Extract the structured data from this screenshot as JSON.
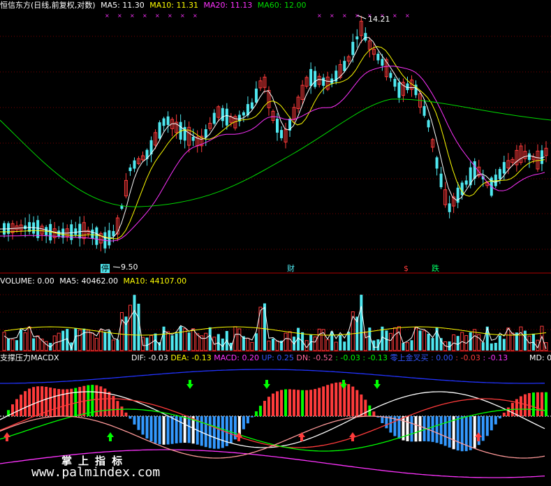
{
  "app": {
    "title": "恒信东方(日线,前复权,对数)"
  },
  "price_panel": {
    "ma5_label": "MA5: 11.30",
    "ma10_label": "MA10: 11.31",
    "ma20_label": "MA20: 11.13",
    "ma60_label": "MA60: 12.00",
    "high_label": "14.21",
    "low_label": "9.50",
    "event_tags": [
      "停",
      "财",
      "$",
      "跌"
    ],
    "colors": {
      "up": "#ff3b3b",
      "down": "#4fe8f0",
      "ma5": "#ffffff",
      "ma10": "#ffff00",
      "ma20": "#ff33ff",
      "ma60": "#00dd00",
      "grid": "#7a0000"
    }
  },
  "volume_panel": {
    "vol_label": "VOLUME: 0.00",
    "ma5_label": "MA5: 40462.00",
    "ma10_label": "MA10: 44107.00"
  },
  "indicator_panel": {
    "name": "支撑压力MACDX",
    "dif": "DIF: -0.03",
    "dea": "DEA: -0.13",
    "macd": "MACD: 0.20",
    "up": "UP: 0.25",
    "dn": "DN: -0.52",
    "v1": ": -0.03",
    "v2": ": -0.13",
    "signal": "零上金叉买",
    "v3": ": 0.00",
    "v4": ": -0.03",
    "v5": ": -0.13",
    "md": "MD: 0"
  },
  "watermark": {
    "line1": "掌 上 指 标",
    "line2": "www.palmindex.com"
  }
}
